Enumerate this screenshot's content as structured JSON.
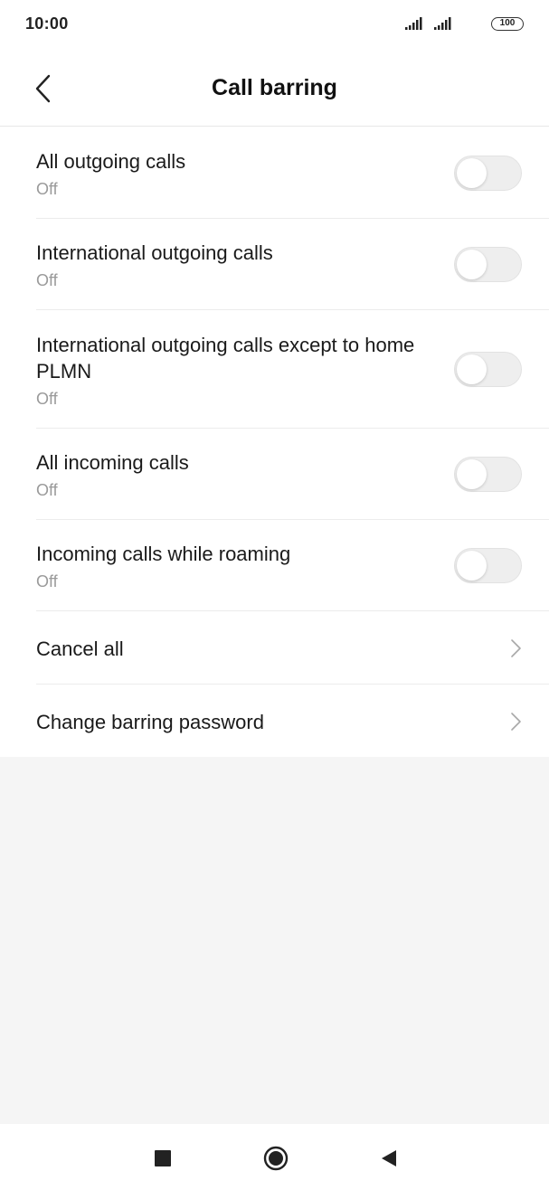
{
  "status_bar": {
    "time": "10:00",
    "battery": "100"
  },
  "header": {
    "title": "Call barring"
  },
  "toggle_items": [
    {
      "title": "All outgoing calls",
      "status": "Off",
      "enabled": false
    },
    {
      "title": "International outgoing calls",
      "status": "Off",
      "enabled": false
    },
    {
      "title": "International outgoing calls except to home PLMN",
      "status": "Off",
      "enabled": false
    },
    {
      "title": "All incoming calls",
      "status": "Off",
      "enabled": false
    },
    {
      "title": "Incoming calls while roaming",
      "status": "Off",
      "enabled": false
    }
  ],
  "link_items": [
    {
      "title": "Cancel all"
    },
    {
      "title": "Change barring password"
    }
  ],
  "icons": {
    "back": "chevron-left-icon",
    "row_arrow": "chevron-right-icon",
    "nav_recents": "square-icon",
    "nav_home": "circle-icon",
    "nav_back": "triangle-left-icon"
  },
  "colors": {
    "background": "#ffffff",
    "empty_area": "#f5f5f5",
    "secondary_text": "#9a9a9a",
    "toggle_off": "#eeeeee"
  }
}
